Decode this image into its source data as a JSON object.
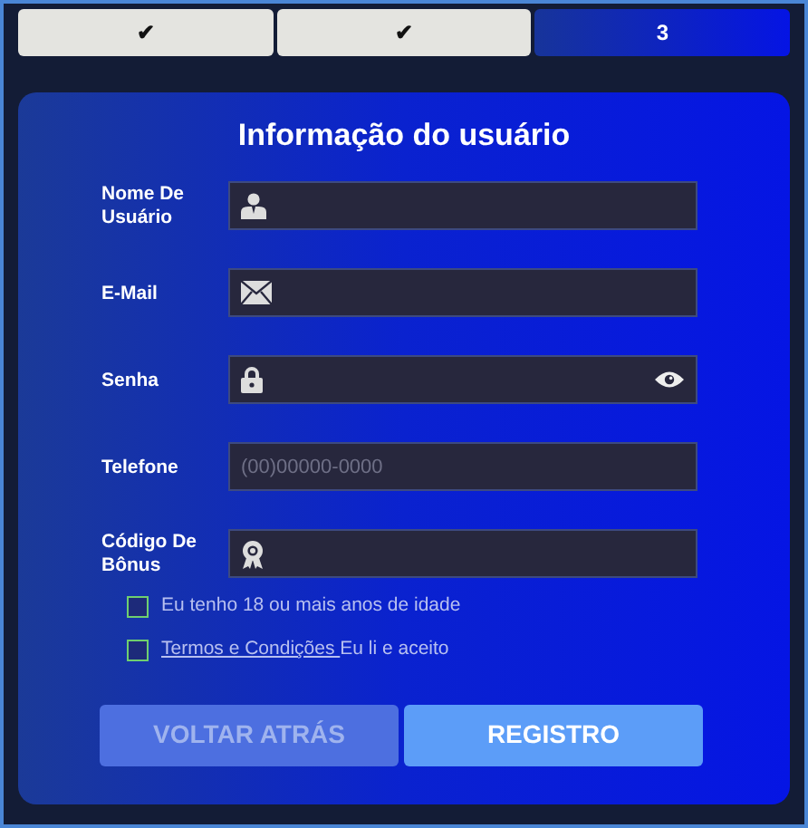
{
  "steps": [
    {
      "label": "✔",
      "selected": false
    },
    {
      "label": "✔",
      "selected": false
    },
    {
      "label": "3",
      "selected": true
    }
  ],
  "form": {
    "title": "Informação do usuário",
    "fields": [
      {
        "kind": "username",
        "label": "Nome De Usuário"
      },
      {
        "kind": "email",
        "label": "E-Mail"
      },
      {
        "kind": "password",
        "label": "Senha"
      },
      {
        "kind": "phone",
        "label": "Telefone",
        "placeholder": "(00)00000-0000"
      },
      {
        "kind": "bonus",
        "label": "Código De Bônus"
      }
    ],
    "checkboxes": [
      {
        "text": "Eu tenho 18 ou mais anos de idade",
        "checked": false
      },
      {
        "link": "Termos e Condições ",
        "text": "Eu li e aceito",
        "checked": false
      }
    ],
    "buttons": [
      {
        "label": "VOLTAR ATRÁS",
        "disabled": true
      },
      {
        "label": "REGISTRO",
        "disabled": false
      }
    ]
  }
}
